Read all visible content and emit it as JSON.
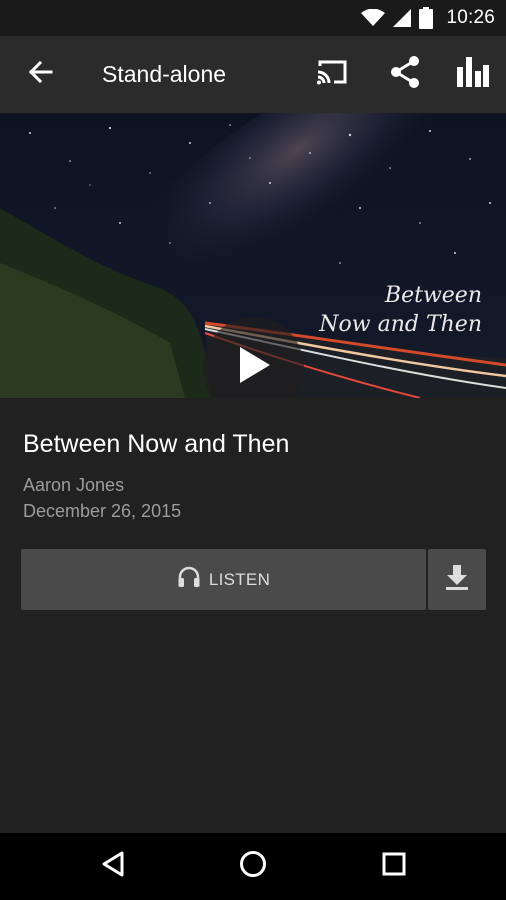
{
  "status_bar": {
    "time": "10:26",
    "icons": [
      "wifi-icon",
      "signal-icon",
      "battery-icon"
    ]
  },
  "app_bar": {
    "title": "Stand-alone",
    "icons": [
      "back-arrow-icon",
      "cast-icon",
      "share-icon",
      "stats-icon"
    ]
  },
  "hero": {
    "cover_text_line1": "Between",
    "cover_text_line2": "Now and Then",
    "play_icon": "play-icon"
  },
  "episode": {
    "title": "Between Now and Then",
    "author": "Aaron Jones",
    "date": "December 26, 2015"
  },
  "actions": {
    "listen_label": "LISTEN",
    "listen_icon": "headphones-icon",
    "download_icon": "download-icon"
  },
  "nav_bar": {
    "icons": [
      "back-triangle-icon",
      "home-circle-icon",
      "recents-square-icon"
    ]
  },
  "colors": {
    "background": "#212121",
    "app_bar": "#2b2b2b",
    "status_bar": "#1a1a1a",
    "button": "#4a4a4a",
    "secondary_text": "#9c9c9c"
  }
}
